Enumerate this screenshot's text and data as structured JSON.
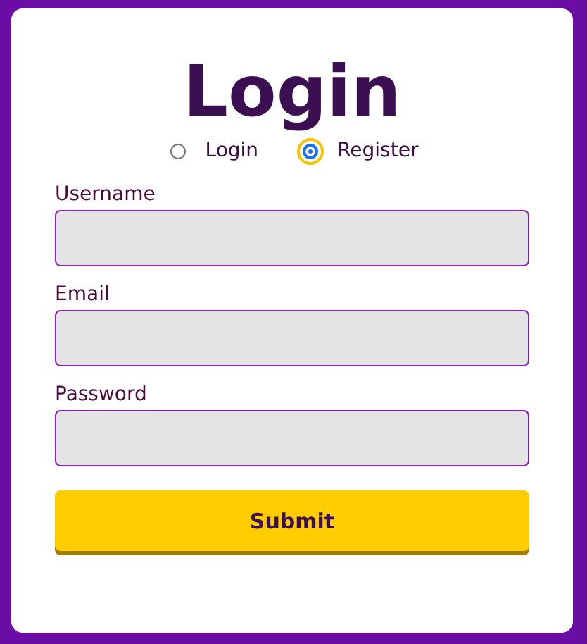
{
  "title": "Login",
  "modes": [
    {
      "label": "Login",
      "selected": false,
      "focused": false
    },
    {
      "label": "Register",
      "selected": true,
      "focused": true
    }
  ],
  "fields": [
    {
      "label": "Username"
    },
    {
      "label": "Email"
    },
    {
      "label": "Password"
    }
  ],
  "submit": "Submit"
}
